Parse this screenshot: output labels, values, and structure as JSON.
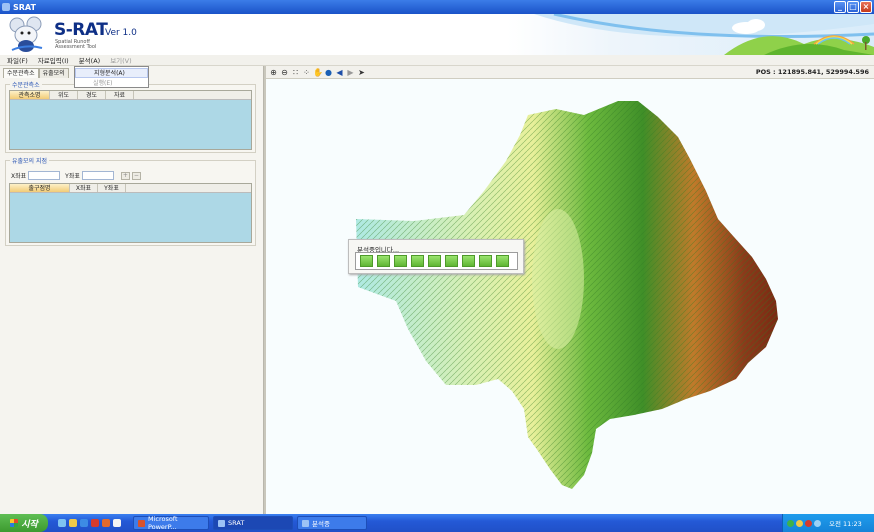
{
  "window": {
    "title": "SRAT",
    "controls": [
      "minimize",
      "maximize",
      "close"
    ]
  },
  "banner": {
    "name": "S-RAT",
    "version": "Ver 1.0",
    "subtitle_line1": "Spatial Runoff",
    "subtitle_line2": "Assessment Tool"
  },
  "menu": {
    "items": [
      {
        "label": "파일(F)",
        "enabled": true
      },
      {
        "label": "자료입력(I)",
        "enabled": true
      },
      {
        "label": "분석(A)",
        "enabled": true
      },
      {
        "label": "보기(V)",
        "enabled": false
      }
    ],
    "dropdown": [
      {
        "label": "지형분석(A)",
        "highlighted": true,
        "enabled": true
      },
      {
        "label": "실행(E)",
        "highlighted": false,
        "enabled": false
      }
    ]
  },
  "left_panel": {
    "tabs": [
      "수문관측소",
      "유출모의"
    ],
    "station_group": {
      "title": "수문관측소",
      "columns": [
        "관측소명",
        "위도",
        "경도",
        "자료"
      ]
    },
    "outlet_group": {
      "title": "유출모의 지점",
      "x_label": "X좌표",
      "x_value": "",
      "y_label": "Y좌표",
      "y_value": "",
      "add_label": "+",
      "remove_label": "−",
      "columns": [
        "출구점명",
        "X좌표",
        "Y좌표"
      ]
    }
  },
  "map_toolbar": {
    "tools": [
      "zoom-in-icon",
      "zoom-out-icon",
      "full-extent-icon",
      "zoom-extent-icon",
      "pan-hand-icon",
      "globe-icon",
      "back-arrow-icon",
      "forward-arrow-icon",
      "pointer-icon"
    ],
    "pos_label": "POS : 121895.841, 529994.596"
  },
  "progress_dialog": {
    "label": "분석중입니다...",
    "filled_blocks": 9,
    "total_blocks": 9
  },
  "colors": {
    "elev_low": "#aee9e3",
    "elev_mid_low": "#e8f09a",
    "elev_mid": "#5fae3a",
    "elev_high": "#2f7a23",
    "elev_peak": "#8a3a1a",
    "water_panel": "#add8e6"
  },
  "taskbar": {
    "start_label": "시작",
    "tasks": [
      {
        "label": "Microsoft PowerP...",
        "active": false
      },
      {
        "label": "SRAT",
        "active": true
      },
      {
        "label": "분석중",
        "active": false
      }
    ],
    "clock": "오전 11:23"
  }
}
